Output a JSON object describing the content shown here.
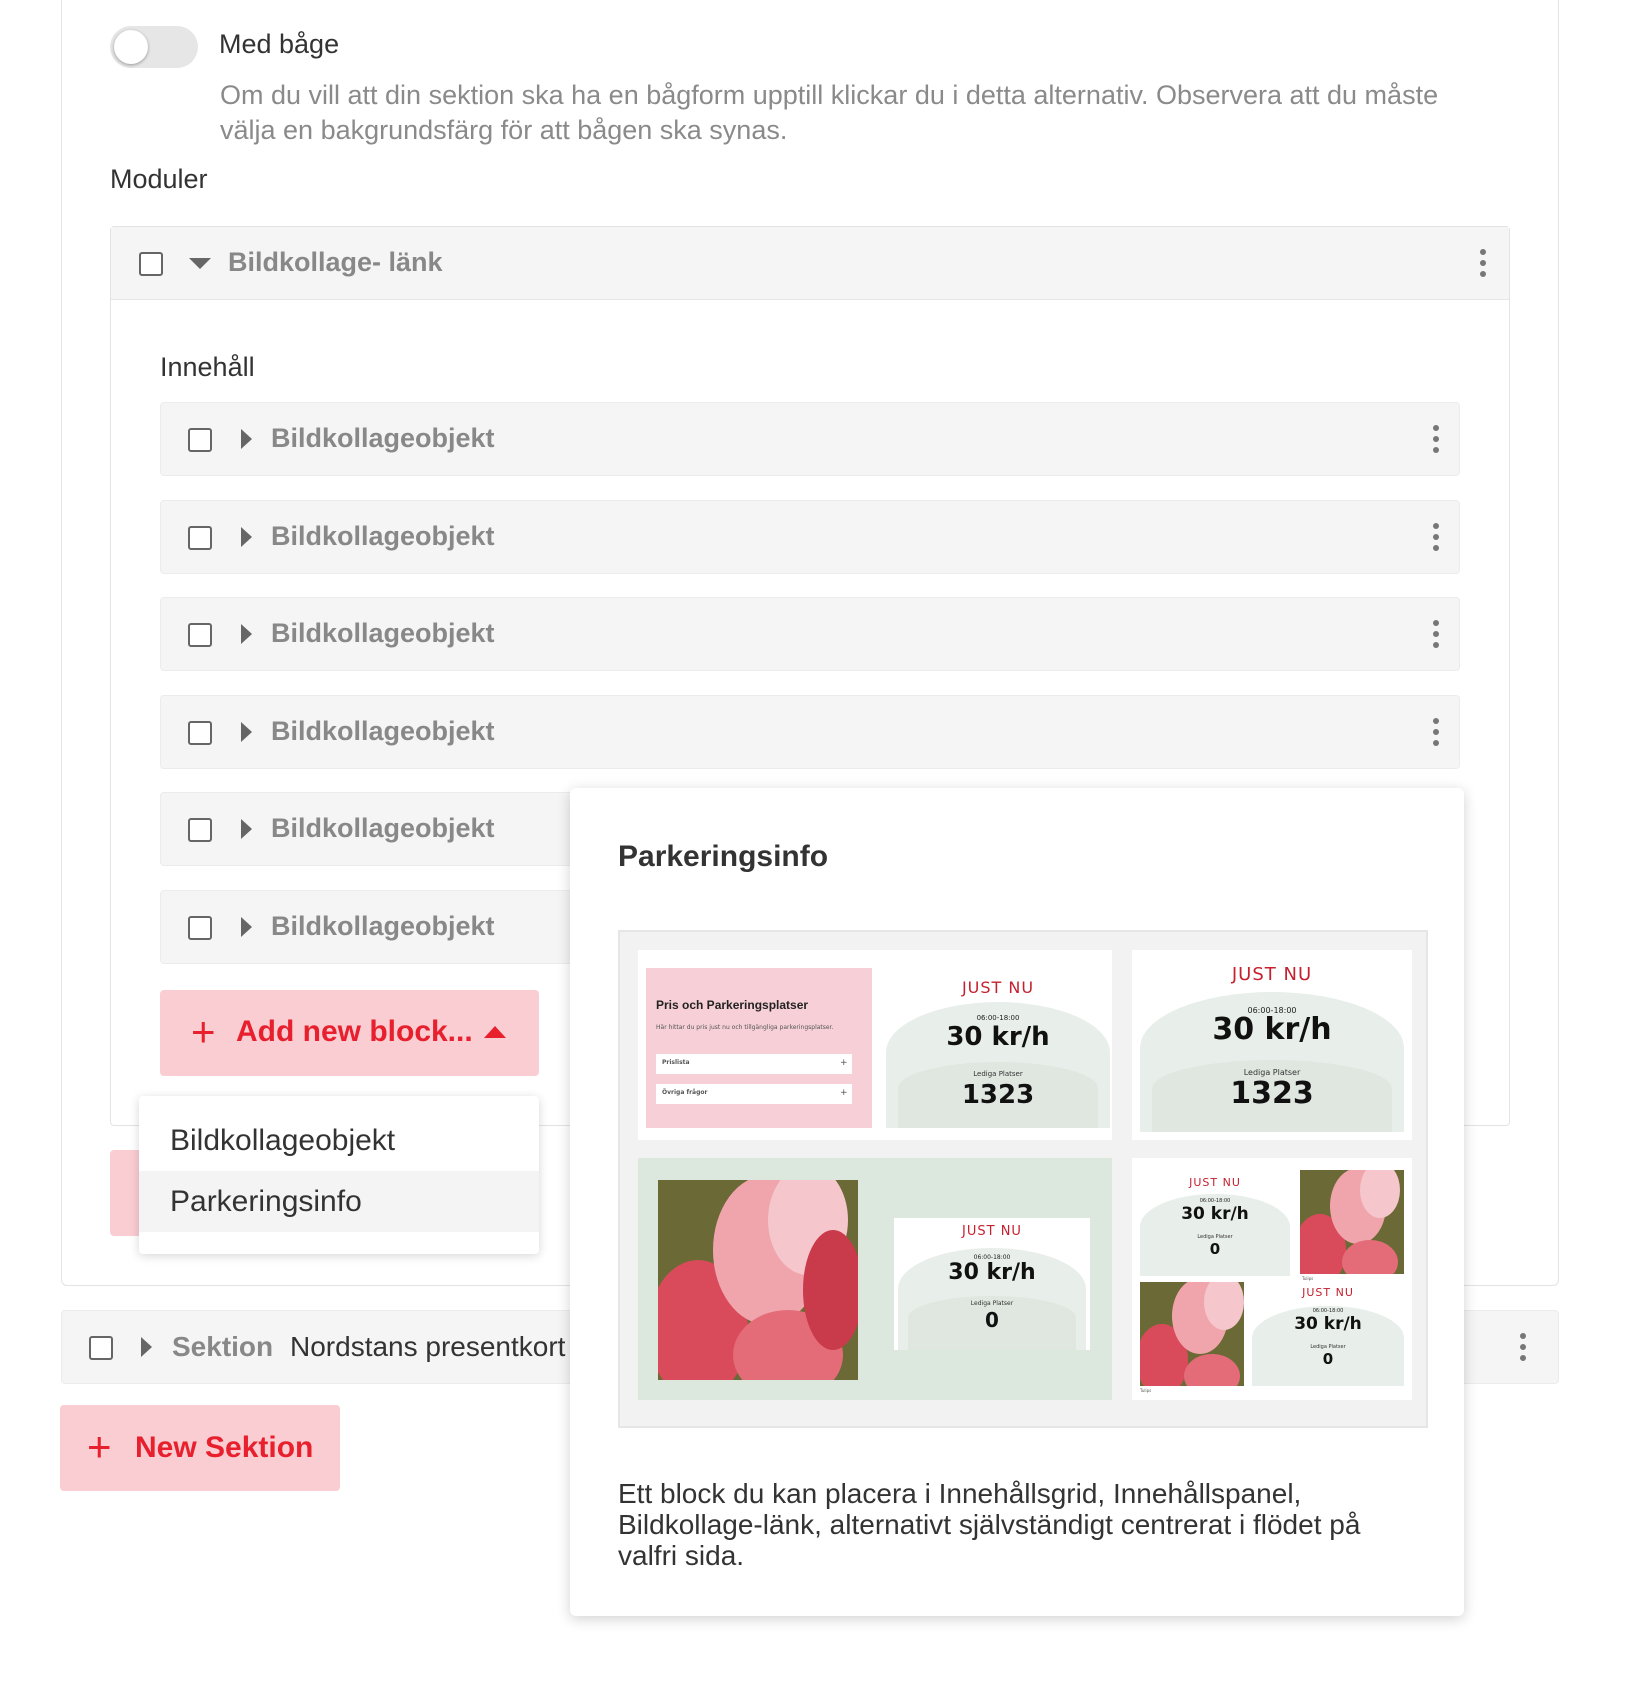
{
  "arch_toggle": {
    "label": "Med båge",
    "help": "Om du vill att din sektion ska ha en bågform upptill klickar du i detta alternativ. Observera att du måste välja en bakgrundsfärg för att bågen ska synas.",
    "state": "off"
  },
  "modules": {
    "heading": "Moduler",
    "module": {
      "title": "Bildkollage- länk",
      "content_heading": "Innehåll",
      "items": [
        {
          "label": "Bildkollageobjekt"
        },
        {
          "label": "Bildkollageobjekt"
        },
        {
          "label": "Bildkollageobjekt"
        },
        {
          "label": "Bildkollageobjekt"
        },
        {
          "label": "Bildkollageobjekt"
        },
        {
          "label": "Bildkollageobjekt"
        }
      ],
      "add_block_label": "Add new block...",
      "add_block_icon": "+"
    }
  },
  "dropdown": {
    "options": [
      "Bildkollageobjekt",
      "Parkeringsinfo"
    ],
    "hovered": "Parkeringsinfo"
  },
  "sektion": {
    "label": "Sektion",
    "name": "Nordstans presentkort"
  },
  "new_sektion": {
    "label": "New Sektion",
    "icon": "+"
  },
  "preview": {
    "title": "Parkeringsinfo",
    "description": "Ett block du kan placera i Innehållsgrid, Innehållspanel, Bildkollage-länk, alternativt självständigt centrerat i flödet på valfri sida.",
    "mock": {
      "just_nu": "JUST NU",
      "hours": "06:00-18:00",
      "price": "30 kr/h",
      "lediga": "Lediga Platser",
      "count_a": "1323",
      "count_b": "0",
      "pris_title": "Pris och Parkeringsplatser",
      "pris_sub": "Här hittar du pris just nu och tillgängliga parkeringsplatser.",
      "prislista": "Prislista",
      "ovriga": "Övriga frågor",
      "caption": "Tulips"
    }
  },
  "colors": {
    "accent": "#e8202e",
    "accent_bg": "#f9cdd2",
    "row_bg": "#f5f5f5",
    "pink_panel": "#f6d0d6",
    "mint": "#dce8de"
  }
}
